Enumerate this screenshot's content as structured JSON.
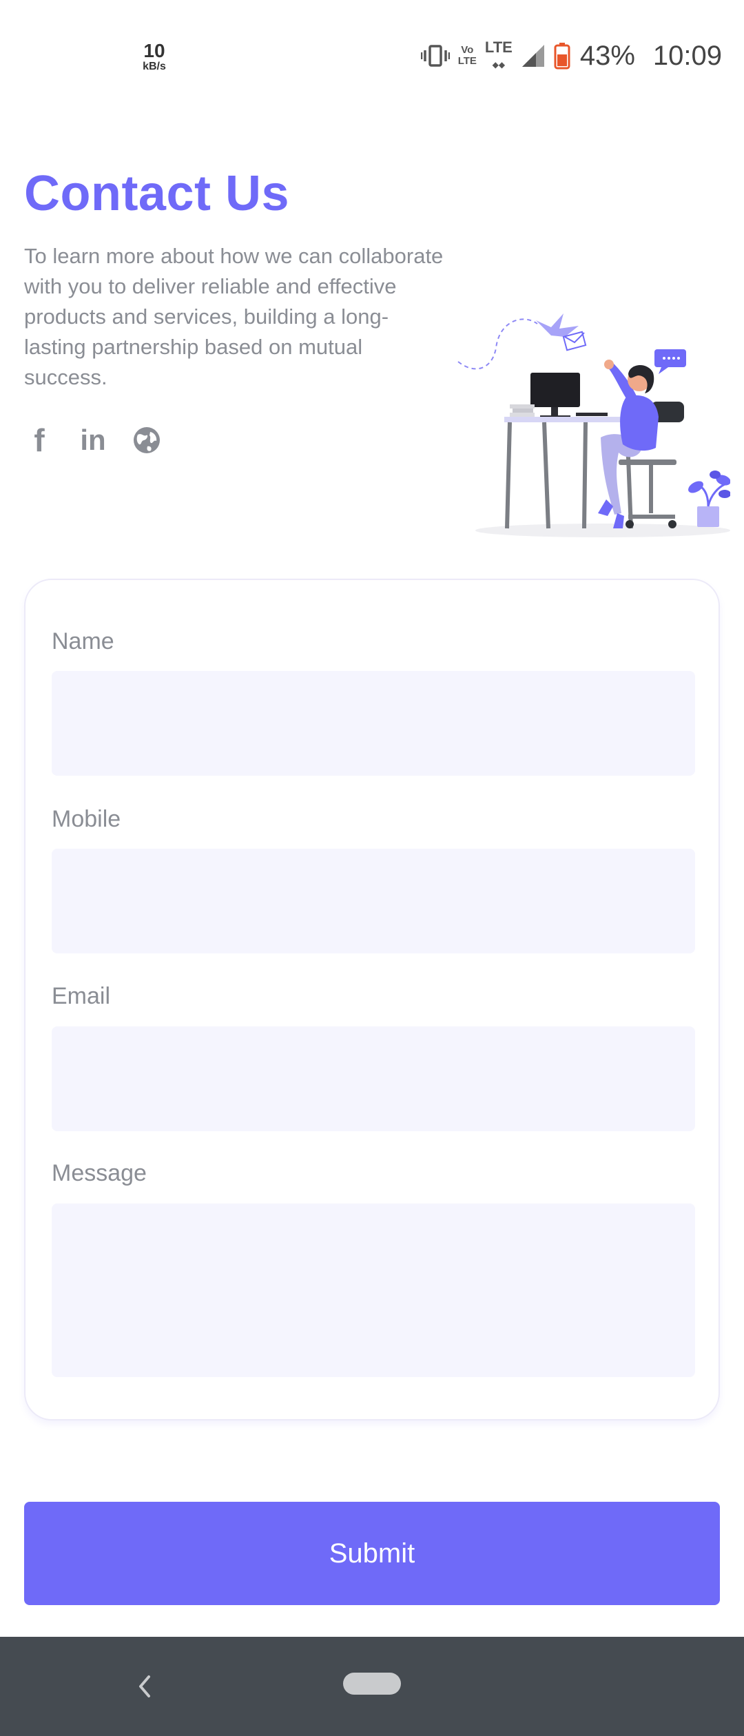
{
  "status_bar": {
    "net_speed_value": "10",
    "net_speed_unit": "kB/s",
    "volte_top": "Vo",
    "volte_bottom": "LTE",
    "lte": "LTE",
    "battery_percent": "43%",
    "time": "10:09"
  },
  "header": {
    "title": "Contact Us",
    "description": "To learn more about how we can collaborate with you to deliver reliable and effective products and services, building a long-lasting partnership based on mutual success."
  },
  "socials": [
    {
      "name": "facebook",
      "glyph": "f"
    },
    {
      "name": "linkedin",
      "glyph": "in"
    },
    {
      "name": "website",
      "glyph": ""
    }
  ],
  "form": {
    "name_label": "Name",
    "name_value": "",
    "mobile_label": "Mobile",
    "mobile_value": "",
    "email_label": "Email",
    "email_value": "",
    "message_label": "Message",
    "message_value": ""
  },
  "submit_label": "Submit",
  "colors": {
    "accent": "#6f6af8",
    "input_bg": "#f5f5fe",
    "muted_text": "#8a8d94",
    "nav_bar": "#454b51"
  }
}
